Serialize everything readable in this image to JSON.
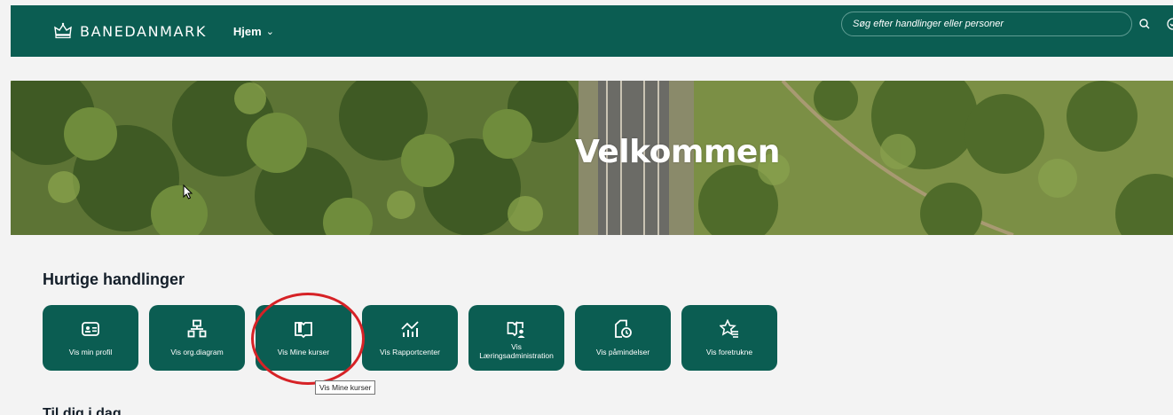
{
  "header": {
    "brand": "BANEDANMARK",
    "nav_label": "Hjem",
    "search_placeholder": "Søg efter handlinger eller personer",
    "bar_color": "#0b5d52"
  },
  "banner": {
    "title": "Velkommen"
  },
  "quick_actions": {
    "title": "Hurtige handlinger",
    "tiles": [
      {
        "label": "Vis min profil",
        "icon": "profile-card-icon"
      },
      {
        "label": "Vis org.diagram",
        "icon": "org-chart-icon"
      },
      {
        "label": "Vis Mine kurser",
        "icon": "open-book-icon"
      },
      {
        "label": "Vis Rapportcenter",
        "icon": "trend-chart-icon"
      },
      {
        "label": "Vis Læringsadministration",
        "label_line1": "Vis",
        "label_line2": "Læringsadministration",
        "icon": "learning-admin-icon"
      },
      {
        "label": "Vis påmindelser",
        "icon": "reminder-clock-icon"
      },
      {
        "label": "Vis foretrukne",
        "icon": "favorites-star-icon"
      }
    ]
  },
  "tooltip": "Vis Mine kurser",
  "next_section_title": "Til dig i dag",
  "highlight_color": "#d62226"
}
